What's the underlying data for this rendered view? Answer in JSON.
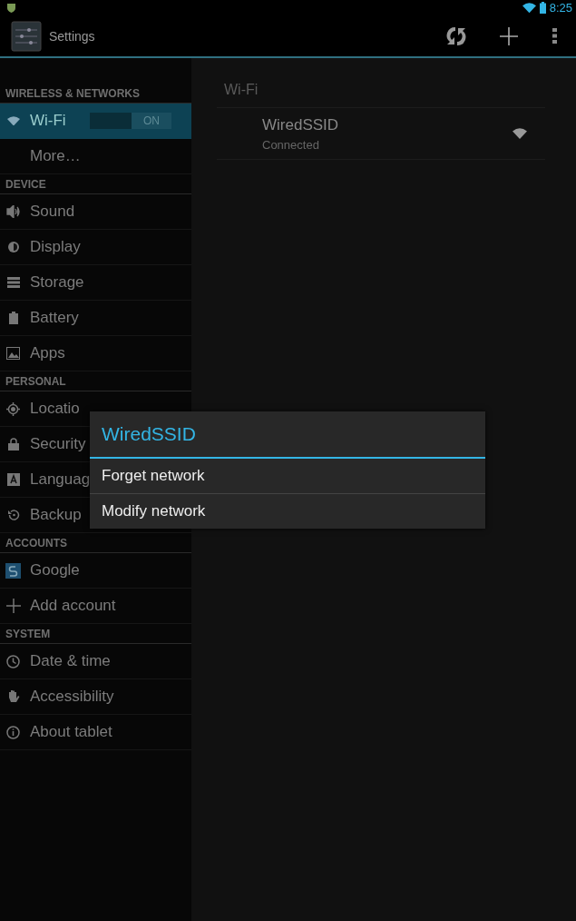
{
  "status_bar": {
    "time": "8:25"
  },
  "action_bar": {
    "title": "Settings"
  },
  "sidebar": {
    "sections": [
      {
        "title": "WIRELESS & NETWORKS",
        "items": [
          {
            "label": "Wi-Fi",
            "selected": true,
            "toggle": {
              "label": "ON",
              "on": true
            }
          },
          {
            "label": "More…",
            "selected": false
          }
        ]
      },
      {
        "title": "DEVICE",
        "items": [
          {
            "label": "Sound",
            "selected": false
          },
          {
            "label": "Display",
            "selected": false
          },
          {
            "label": "Storage",
            "selected": false
          },
          {
            "label": "Battery",
            "selected": false
          },
          {
            "label": "Apps",
            "selected": false
          }
        ]
      },
      {
        "title": "PERSONAL",
        "items": [
          {
            "label": "Locatio",
            "selected": false
          },
          {
            "label": "Security",
            "selected": false
          },
          {
            "label": "Languag",
            "selected": false
          },
          {
            "label": "Backup",
            "selected": false
          }
        ]
      },
      {
        "title": "ACCOUNTS",
        "items": [
          {
            "label": "Google",
            "selected": false
          },
          {
            "label": "Add account",
            "selected": false
          }
        ]
      },
      {
        "title": "SYSTEM",
        "items": [
          {
            "label": "Date & time",
            "selected": false
          },
          {
            "label": "Accessibility",
            "selected": false
          },
          {
            "label": "About tablet",
            "selected": false
          }
        ]
      }
    ]
  },
  "content": {
    "heading": "Wi-Fi",
    "networks": [
      {
        "name": "WiredSSID",
        "status": "Connected"
      }
    ]
  },
  "dialog": {
    "title": "WiredSSID",
    "items": [
      "Forget network",
      "Modify network"
    ]
  }
}
